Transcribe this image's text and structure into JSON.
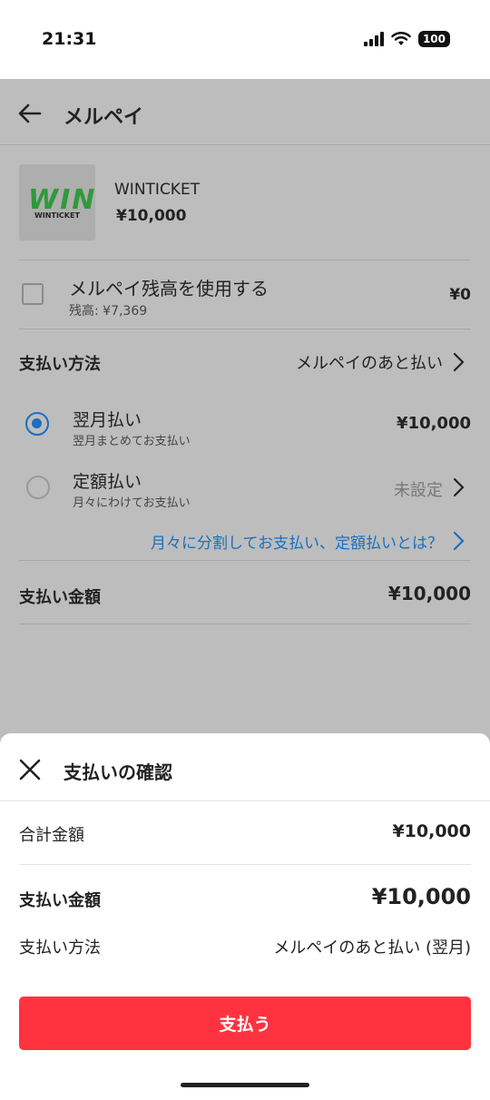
{
  "status": {
    "time": "21:31",
    "battery": "100"
  },
  "header": {
    "title": "メルペイ"
  },
  "merchant": {
    "logo_text": "WIN",
    "logo_sub": "WINTICKET",
    "name": "WINTICKET",
    "amount": "¥10,000"
  },
  "balance": {
    "label": "メルペイ残高を使用する",
    "sub": "残高: ¥7,369",
    "value": "¥0"
  },
  "method": {
    "label": "支払い方法",
    "value": "メルペイのあと払い"
  },
  "options": [
    {
      "label": "翌月払い",
      "sub": "翌月まとめてお支払い",
      "value": "¥10,000",
      "selected": true
    },
    {
      "label": "定額払い",
      "sub": "月々にわけてお支払い",
      "value": "未設定",
      "selected": false
    }
  ],
  "info_link": "月々に分割してお支払い、定額払いとは？",
  "total": {
    "label": "支払い金額",
    "value": "¥10,000"
  },
  "sheet": {
    "title": "支払いの確認",
    "subtotal_label": "合計金額",
    "subtotal_value": "¥10,000",
    "pay_amount_label": "支払い金額",
    "pay_amount_value": "¥10,000",
    "method_label": "支払い方法",
    "method_value": "メルペイのあと払い (翌月)",
    "pay_button": "支払う"
  },
  "colors": {
    "accent_red": "#ff333f",
    "link_blue": "#1a6fc0",
    "overlay": "#bdbdbd",
    "logo_green": "#2f9a3a"
  }
}
